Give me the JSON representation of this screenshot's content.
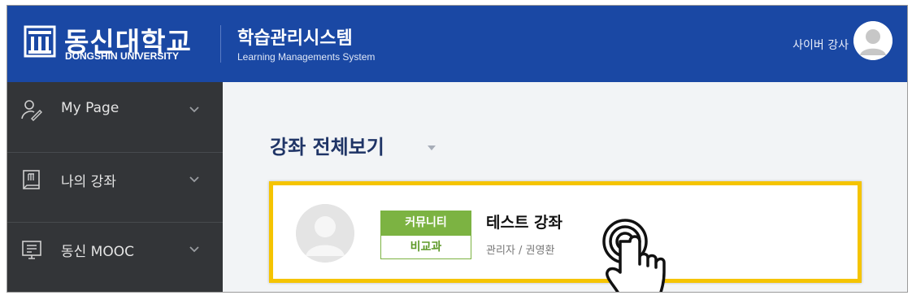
{
  "header": {
    "logo_name": "동신대학교",
    "logo_sub": "DONGSHIN UNIVERSITY",
    "system_title": "학습관리시스템",
    "system_subtitle": "Learning Managements System",
    "user_name": "사이버 강사",
    "avatar_icon": "user-avatar-icon"
  },
  "sidebar": {
    "items": [
      {
        "label": "My Page",
        "icon": "user-pen-icon"
      },
      {
        "label": "나의 강좌",
        "icon": "book-icon"
      },
      {
        "label": "동신 MOOC",
        "icon": "monitor-icon"
      }
    ]
  },
  "main": {
    "page_title": "강좌 전체보기",
    "course": {
      "badge_top": "커뮤니티",
      "badge_bottom": "비교과",
      "title": "테스트 강좌",
      "meta": "관리자 / 권영환"
    }
  },
  "colors": {
    "header_bg": "#1a48a4",
    "sidebar_bg": "#333538",
    "highlight": "#f5c400",
    "badge_green": "#7cb342",
    "title_navy": "#1f3466"
  },
  "overlay": {
    "icon": "tap-hand-icon"
  }
}
